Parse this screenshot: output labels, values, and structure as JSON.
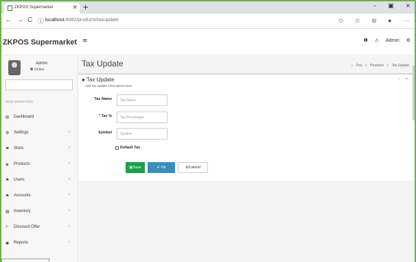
{
  "browser": {
    "tab_title": "ZKPOS Supermarket",
    "tab_close": "×",
    "new_tab": "+",
    "nav_back": "←",
    "nav_forward": "→",
    "reload": "C",
    "info": "ⓘ",
    "url_host": "localhost",
    "url_rest": ":8082/products/taxupdate",
    "win_min": "–",
    "win_max": "▣",
    "win_close": "×",
    "tool_icons": [
      "✩",
      "✩",
      "⊜",
      "●",
      "···"
    ]
  },
  "header": {
    "brand": "ZKPOS Supermarket",
    "hamburger": "≡",
    "icons": [
      "❶",
      "⚠"
    ],
    "user_label": "Admin",
    "settings": "⚙"
  },
  "sidebar": {
    "user_name": "Admin",
    "user_status": "Online",
    "nav_heading": "MAIN NAVIGATION",
    "items": [
      {
        "icon": "⊞",
        "label": "Dashboard",
        "chevron": ""
      },
      {
        "icon": "⚙",
        "label": "Settings",
        "chevron": "‹"
      },
      {
        "icon": "⚑",
        "label": "Store",
        "chevron": "‹"
      },
      {
        "icon": "◈",
        "label": "Products",
        "chevron": "‹"
      },
      {
        "icon": "⚑",
        "label": "Users",
        "chevron": "‹"
      },
      {
        "icon": "⚑",
        "label": "Accounts",
        "chevron": "‹"
      },
      {
        "icon": "▤",
        "label": "Inventory",
        "chevron": "‹"
      },
      {
        "icon": "+",
        "label": "Discount Offer",
        "chevron": "‹"
      },
      {
        "icon": "◉",
        "label": "Reports",
        "chevron": "‹"
      }
    ]
  },
  "page": {
    "title": "Tax Update",
    "breadcrumb": [
      "Pos",
      ">",
      "Products",
      ">",
      "Tax Update"
    ],
    "card_title": "Tax Update",
    "card_subtitle": "Add Tax Update informations here.",
    "card_controls": [
      "−",
      "×"
    ],
    "fields": {
      "tax_name_label": "Tax Name",
      "tax_name_placeholder": "Tax Name",
      "tax_pct_required": "*",
      "tax_pct_label": "Tax %",
      "tax_pct_placeholder": "Tax Percentage",
      "symbol_label": "Symbol",
      "symbol_placeholder": "Symbol",
      "default_tax_label": "Default Tax"
    },
    "buttons": {
      "save": "Save",
      "ok": "Ok",
      "cancel": "Cancel"
    }
  }
}
